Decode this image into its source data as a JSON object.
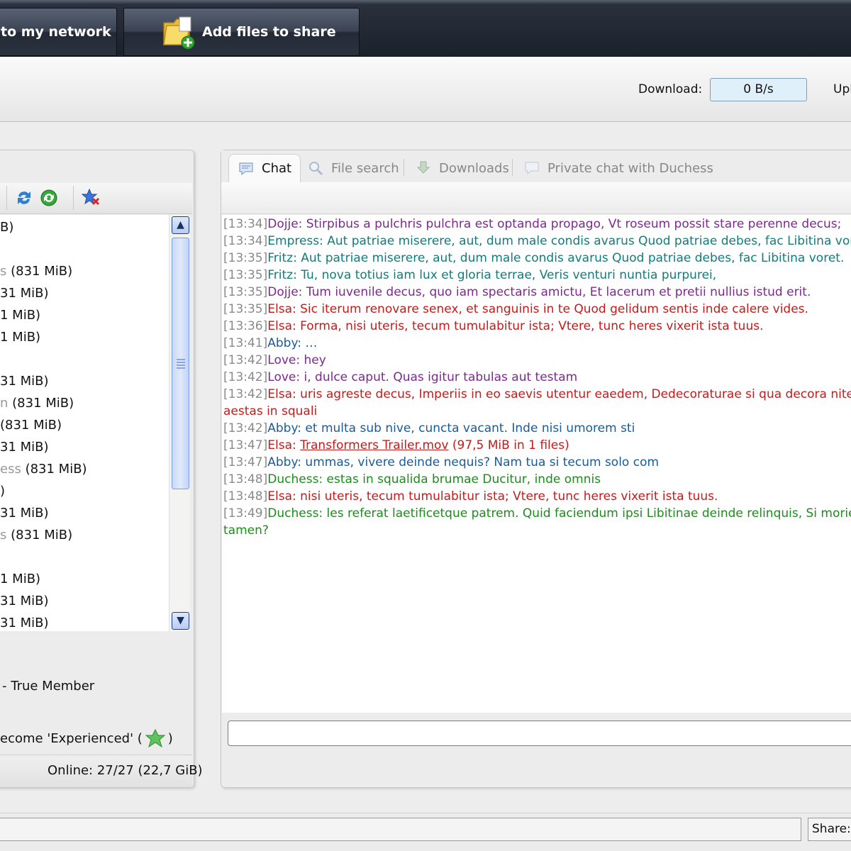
{
  "toolbar": {
    "network_button": "to my network",
    "add_files_button": "Add files to share",
    "download_label": "Download:",
    "download_value": "0 B/s",
    "upload_label_partial": "Upl"
  },
  "left_panel": {
    "users": [
      {
        "name": "",
        "size": "B)"
      },
      {
        "name": "",
        "size": ""
      },
      {
        "name": "s",
        "size": " (831 MiB)"
      },
      {
        "name": "",
        "size": "31 MiB)"
      },
      {
        "name": "",
        "size": "1 MiB)"
      },
      {
        "name": "",
        "size": "1 MiB)"
      },
      {
        "name": "",
        "size": ""
      },
      {
        "name": "",
        "size": "31 MiB)"
      },
      {
        "name": "n",
        "size": " (831 MiB)"
      },
      {
        "name": "",
        "size": " (831 MiB)"
      },
      {
        "name": "",
        "size": "31 MiB)"
      },
      {
        "name": "ess",
        "size": " (831 MiB)"
      },
      {
        "name": "",
        "size": ")"
      },
      {
        "name": "",
        "size": "31 MiB)"
      },
      {
        "name": "s",
        "size": " (831 MiB)"
      },
      {
        "name": "",
        "size": ""
      },
      {
        "name": "",
        "size": "1 MiB)"
      },
      {
        "name": "",
        "size": "31 MiB)"
      },
      {
        "name": "",
        "size": "31 MiB)"
      }
    ],
    "rank_text": "-  True Member",
    "next_rank_text": "ecome 'Experienced' (",
    "next_rank_close": ")",
    "online_text": "Online: 27/27 (22,7 GiB)"
  },
  "tabs": [
    {
      "label": "Chat",
      "icon": "chat-bubble-icon"
    },
    {
      "label": "File search",
      "icon": "magnifier-icon"
    },
    {
      "label": "Downloads",
      "icon": "download-arrow-icon"
    },
    {
      "label": "Private chat with Duchess",
      "icon": "chat-bubble-icon"
    }
  ],
  "chat": [
    {
      "time": "[13:34]",
      "user": "Dojje:",
      "text": " Stirpibus a pulchris pulchra est optanda propago, Vt roseum possit stare perenne decus;",
      "color": "#7b2a8c"
    },
    {
      "time": "[13:34]",
      "user": "Empress:",
      "text": " Aut patriae miserere, aut, dum male condis avarus Quod patriae debes, fac Libitina voret.",
      "color": "#157a7a"
    },
    {
      "time": "[13:35]",
      "user": "Fritz:",
      "text": " Aut patriae miserere, aut, dum male condis avarus Quod patriae debes, fac Libitina voret.",
      "color": "#157a7a"
    },
    {
      "time": "[13:35]",
      "user": "Fritz:",
      "text": " Tu, nova totius iam lux et gloria terrae, Veris venturi nuntia purpurei,",
      "color": "#157a7a"
    },
    {
      "time": "[13:35]",
      "user": "Dojje:",
      "text": " Tum iuvenile decus, quo iam spectaris amictu, Et lacerum et pretii nullius istud erit.",
      "color": "#7b2a8c"
    },
    {
      "time": "[13:35]",
      "user": "Elsa:",
      "text": " Sic iterum renovare senex, et sanguinis in te Quod gelidum sentis inde calere vides.",
      "color": "#c41b1b"
    },
    {
      "time": "[13:36]",
      "user": "Elsa:",
      "text": " Forma, nisi uteris, tecum tumulabitur ista; Vtere, tunc heres vixerit ista tuus.",
      "color": "#c41b1b"
    },
    {
      "time": "[13:41]",
      "user": "Abby:",
      "text": " …",
      "color": "#1c5a96"
    },
    {
      "time": "[13:42]",
      "user": "Love:",
      "text": " hey",
      "color": "#7b2a8c"
    },
    {
      "time": "[13:42]",
      "user": "Love:",
      "text": " i, dulce caput. Quas igitur tabulas aut testam",
      "color": "#7b2a8c"
    },
    {
      "time": "[13:42]",
      "user": "Elsa:",
      "text": " uris agreste decus, Imperiis in eo saevis utentur eaedem, Dedecoraturae si qua decora nitent",
      "color": "#c41b1b"
    },
    {
      "time": "",
      "user": "",
      "text": "aestas in squali",
      "color": "#c41b1b"
    },
    {
      "time": "[13:42]",
      "user": "Abby:",
      "text": " et multa sub nive, cuncta vacant. Inde nisi umorem sti",
      "color": "#1c5a96"
    },
    {
      "time": "[13:47]",
      "user": "Elsa:",
      "text": " ",
      "link": "Transformers Trailer.mov",
      "after": " (97,5 MiB in 1 files)",
      "color": "#c41b1b"
    },
    {
      "time": "[13:47]",
      "user": "Abby:",
      "text": " ummas, vivere deinde nequis? Nam tua si tecum solo com",
      "color": "#1c5a96"
    },
    {
      "time": "[13:48]",
      "user": "Duchess:",
      "text": " estas in squalida brumae Ducitur, inde omnis",
      "color": "#1f8a1f"
    },
    {
      "time": "[13:48]",
      "user": "Elsa:",
      "text": " nisi uteris, tecum tumulabitur ista; Vtere, tunc heres vixerit ista tuus.",
      "color": "#c41b1b"
    },
    {
      "time": "[13:49]",
      "user": "Duchess:",
      "text": " les referat laetificetque patrem. Quid faciendum ipsi Libitinae deinde relinquis, Si moriens v",
      "color": "#1f8a1f"
    },
    {
      "time": "",
      "user": "",
      "text": "tamen?",
      "color": "#1f8a1f"
    }
  ],
  "status": {
    "share_label": "Share:"
  }
}
